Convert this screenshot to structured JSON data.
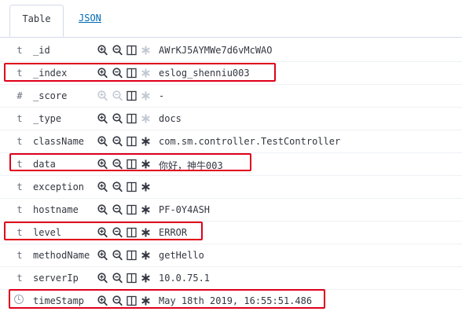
{
  "tabs": {
    "table_label": "Table",
    "json_label": "JSON"
  },
  "rows": [
    {
      "type": "t",
      "name": "_id",
      "value": "AWrKJ5AYMWe7d6vMcWAO",
      "filterable": true,
      "star_muted": true
    },
    {
      "type": "t",
      "name": "_index",
      "value": "eslog_shenniu003",
      "filterable": true,
      "star_muted": true
    },
    {
      "type": "#",
      "name": "_score",
      "value": " -",
      "filterable": false,
      "star_muted": true
    },
    {
      "type": "t",
      "name": "_type",
      "value": "docs",
      "filterable": true,
      "star_muted": true
    },
    {
      "type": "t",
      "name": "className",
      "value": "com.sm.controller.TestController",
      "filterable": true,
      "star_muted": false
    },
    {
      "type": "t",
      "name": "data",
      "value": "你好，神牛003",
      "filterable": true,
      "star_muted": false
    },
    {
      "type": "t",
      "name": "exception",
      "value": "",
      "filterable": true,
      "star_muted": false
    },
    {
      "type": "t",
      "name": "hostname",
      "value": "PF-0Y4ASH",
      "filterable": true,
      "star_muted": false
    },
    {
      "type": "t",
      "name": "level",
      "value": "ERROR",
      "filterable": true,
      "star_muted": false
    },
    {
      "type": "t",
      "name": "methodName",
      "value": "getHello",
      "filterable": true,
      "star_muted": false
    },
    {
      "type": "t",
      "name": "serverIp",
      "value": "10.0.75.1",
      "filterable": true,
      "star_muted": false
    },
    {
      "type": "clock",
      "name": "timeStamp",
      "value": "May 18th 2019, 16:55:51.486",
      "filterable": true,
      "star_muted": false
    }
  ],
  "colors": {
    "highlight": "#e0001b",
    "link": "#006bb4",
    "muted_icon": "#c2c9d3",
    "icon": "#343741"
  },
  "icons": {
    "zoom_in": "magnifier-plus-icon",
    "zoom_out": "magnifier-minus-icon",
    "column": "column-toggle-icon",
    "exists": "asterisk-icon",
    "date_type": "clock-icon"
  },
  "highlighted_fields": [
    "_index",
    "data",
    "level",
    "timeStamp"
  ]
}
